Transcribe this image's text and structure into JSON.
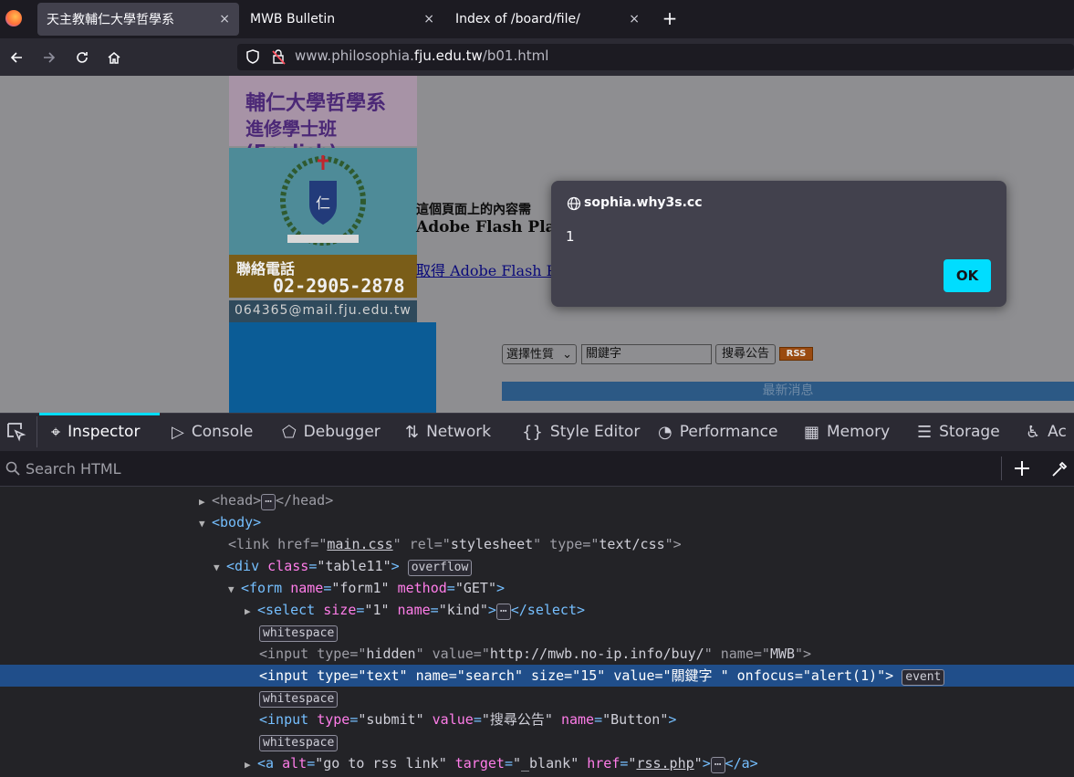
{
  "tabs": [
    {
      "label": "天主教輔仁大學哲學系",
      "close": "×"
    },
    {
      "label": "MWB Bulletin",
      "close": "×"
    },
    {
      "label": "Index of /board/file/",
      "close": "×"
    }
  ],
  "new_tab": "+",
  "url": {
    "prefix": "www.philosophia.",
    "domain": "fju.edu.tw",
    "path": "/b01.html"
  },
  "page": {
    "banner_line1": "輔仁大學哲學系",
    "banner_line2": "進修學士班(English)",
    "contact_label": "聯絡電話",
    "phone": "02-2905-2878",
    "email": "064365@mail.fju.edu.tw",
    "flash_msg": "這個頁面上的內容需",
    "flash_name": "Adobe Flash Play",
    "flash_link": "取得 Adobe Flash P",
    "select_value": "選擇性質",
    "search_value": "關鍵字",
    "search_button": "搜尋公告",
    "rss": "RSS",
    "news_header": "最新消息"
  },
  "dialog": {
    "origin": "sophia.why3s.cc",
    "message": "1",
    "ok": "OK"
  },
  "devtools": {
    "tabs": [
      "Inspector",
      "Console",
      "Debugger",
      "Network",
      "Style Editor",
      "Performance",
      "Memory",
      "Storage",
      "Ac"
    ],
    "search_placeholder": "Search HTML"
  },
  "colors": {
    "accent": "#00ddff",
    "selection": "#204e8a",
    "tag": "#75bfff",
    "attr": "#ff7de9"
  }
}
